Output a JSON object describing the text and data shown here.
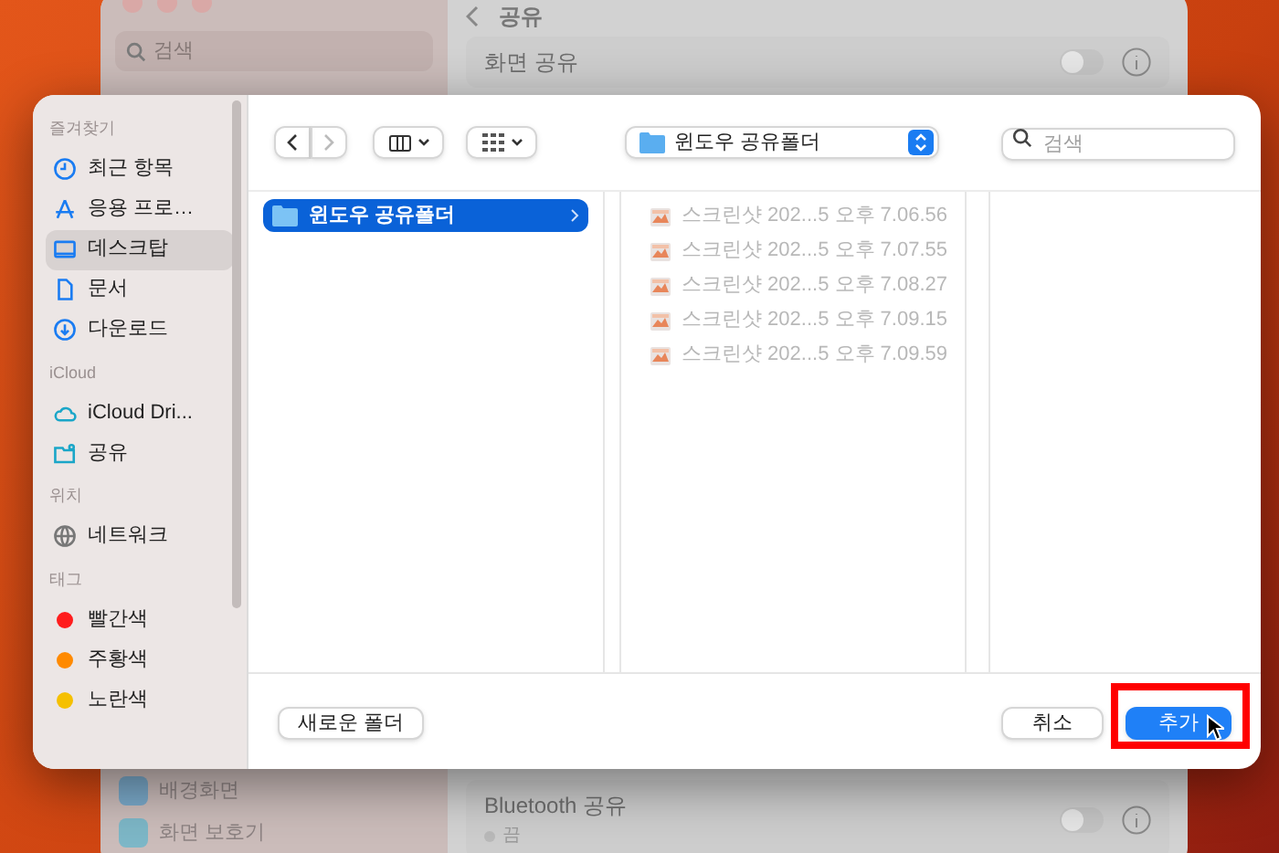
{
  "background_window": {
    "title": "공유",
    "search": {
      "placeholder": "검색"
    },
    "top_rows": [
      {
        "label": "화면 공유",
        "on": false
      }
    ],
    "sidebar_items": [
      {
        "label": "배경화면",
        "kind": "wallpaper"
      },
      {
        "label": "화면 보호기",
        "kind": "screensaver"
      }
    ],
    "bottom_rows": [
      {
        "label": "Bluetooth 공유",
        "status": "끔",
        "on": false
      }
    ]
  },
  "dialog": {
    "sidebar": [
      {
        "heading": "즐겨찾기",
        "items": [
          {
            "label": "최근 항목",
            "kind": "clock",
            "selected": false
          },
          {
            "label": "응용 프로…",
            "kind": "apps",
            "selected": false
          },
          {
            "label": "데스크탑",
            "kind": "desktop",
            "selected": true
          },
          {
            "label": "문서",
            "kind": "document",
            "selected": false
          },
          {
            "label": "다운로드",
            "kind": "download",
            "selected": false
          }
        ]
      },
      {
        "heading": "iCloud",
        "items": [
          {
            "label": "iCloud Dri...",
            "kind": "cloud",
            "selected": false
          },
          {
            "label": "공유",
            "kind": "shared",
            "selected": false
          }
        ]
      },
      {
        "heading": "위치",
        "items": [
          {
            "label": "네트워크",
            "kind": "network",
            "selected": false
          }
        ]
      },
      {
        "heading": "태그",
        "items": [
          {
            "label": "빨간색",
            "kind": "tag",
            "color": "#ff1d1d",
            "selected": false
          },
          {
            "label": "주황색",
            "kind": "tag",
            "color": "#ff8a00",
            "selected": false
          },
          {
            "label": "노란색",
            "kind": "tag",
            "color": "#f5c000",
            "selected": false
          }
        ]
      }
    ],
    "toolbar": {
      "back_disabled": false,
      "forward_disabled": true,
      "location": "윈도우 공유폴더",
      "search": {
        "placeholder": "검색"
      }
    },
    "columns": [
      [
        {
          "label": "윈도우 공유폴더",
          "kind": "folder",
          "selected": true
        }
      ],
      [
        {
          "label": "스크린샷 202...5 오후 7.06.56",
          "kind": "image",
          "disabled": true
        },
        {
          "label": "스크린샷 202...5 오후 7.07.55",
          "kind": "image",
          "disabled": true
        },
        {
          "label": "스크린샷 202...5 오후 7.08.27",
          "kind": "image",
          "disabled": true
        },
        {
          "label": "스크린샷 202...5 오후 7.09.15",
          "kind": "image",
          "disabled": true
        },
        {
          "label": "스크린샷 202...5 오후 7.09.59",
          "kind": "image",
          "disabled": true
        }
      ],
      []
    ],
    "buttons": [
      {
        "label": "새로운 폴더",
        "kind": "plain",
        "highlighted": false
      },
      {
        "label": "취소",
        "kind": "plain",
        "highlighted": false
      },
      {
        "label": "추가",
        "kind": "default",
        "highlighted": true
      }
    ]
  }
}
